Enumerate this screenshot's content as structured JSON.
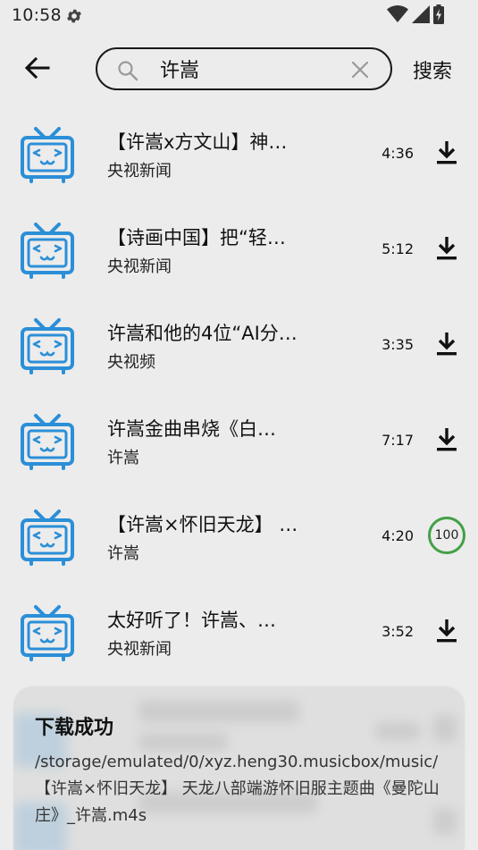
{
  "status_bar": {
    "time": "10:58",
    "icons": [
      "settings-gear",
      "wifi-full",
      "signal-full",
      "battery-charging"
    ]
  },
  "search": {
    "query": "许嵩",
    "submit_label": "搜索"
  },
  "results": [
    {
      "title": "【许嵩x方文山】神…",
      "channel": "央视新闻",
      "duration": "4:36",
      "state": "download"
    },
    {
      "title": "【诗画中国】把“轻…",
      "channel": "央视新闻",
      "duration": "5:12",
      "state": "download"
    },
    {
      "title": "许嵩和他的4位“AI分…",
      "channel": "央视频",
      "duration": "3:35",
      "state": "download"
    },
    {
      "title": "许嵩金曲串烧《白…",
      "channel": "许嵩",
      "duration": "7:17",
      "state": "download"
    },
    {
      "title": "【许嵩×怀旧天龙】 …",
      "channel": "许嵩",
      "duration": "4:20",
      "state": "progress",
      "progress": "100"
    },
    {
      "title": "太好听了！许嵩、…",
      "channel": "央视新闻",
      "duration": "3:52",
      "state": "download"
    }
  ],
  "toast": {
    "title": "下载成功",
    "message": "/storage/emulated/0/xyz.heng30.musicbox/music/【许嵩×怀旧天龙】 天龙八部端游怀旧服主题曲《曼陀山庄》_许嵩.m4s"
  },
  "colors": {
    "background": "#ececec",
    "tv_icon": "#2b8fd8",
    "progress_ring": "#43a047"
  }
}
